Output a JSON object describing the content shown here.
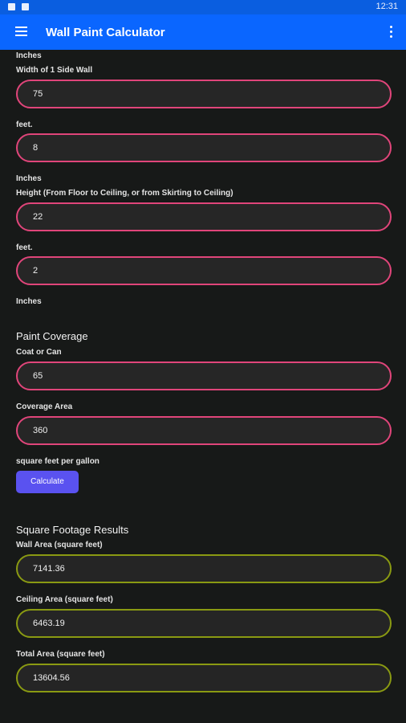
{
  "status_bar": {
    "time": "12:31"
  },
  "app_bar": {
    "title": "Wall Paint Calculator",
    "menu_icon": "menu-icon",
    "more_icon": "more-vert-icon"
  },
  "form": {
    "inches_label_top": "Inches",
    "width_label": "Width of 1 Side Wall",
    "width_feet_value": "75",
    "width_feet_unit": "feet.",
    "width_inches_value": "8",
    "width_inches_unit": "Inches",
    "height_label": "Height (From Floor to Ceiling, or from Skirting to Ceiling)",
    "height_feet_value": "22",
    "height_feet_unit": "feet.",
    "height_inches_value": "2",
    "height_inches_unit": "Inches"
  },
  "coverage": {
    "title": "Paint Coverage",
    "coat_label": "Coat or Can",
    "coat_value": "65",
    "area_label": "Coverage Area",
    "area_value": "360",
    "area_unit": "square feet per gallon",
    "calculate_label": "Calculate"
  },
  "results": {
    "title": "Square Footage Results",
    "wall_label": "Wall Area (square feet)",
    "wall_value": "7141.36",
    "ceiling_label": "Ceiling Area (square feet)",
    "ceiling_value": "6463.19",
    "total_label": "Total Area (square feet)",
    "total_value": "13604.56"
  },
  "colors": {
    "app_bar": "#0a66ff",
    "status_bar": "#0a5ee0",
    "input_border": "#e0457a",
    "result_border": "#8a9a12",
    "button": "#5a52f0"
  }
}
